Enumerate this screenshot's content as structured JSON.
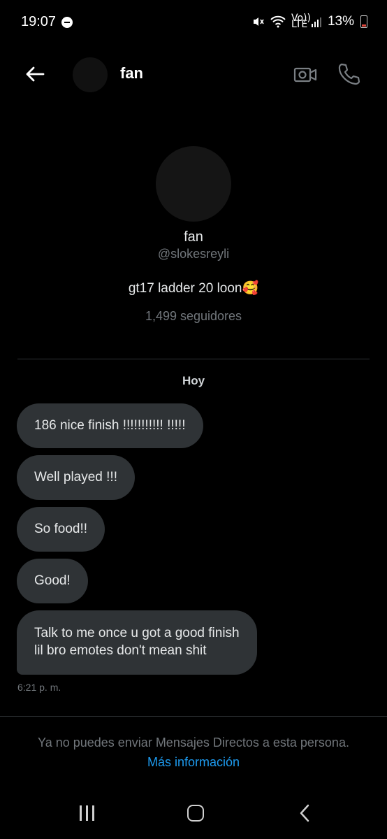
{
  "status_bar": {
    "time": "19:07",
    "battery": "13%",
    "volte": "Vo)) LTE"
  },
  "header": {
    "name": "fan"
  },
  "profile": {
    "name": "fan",
    "handle": "@slokesreyli",
    "bio": "gt17 ladder 20 loon🥰",
    "followers": "1,499 seguidores"
  },
  "conversation": {
    "day_label": "Hoy",
    "messages": [
      "186 nice finish !!!!!!!!!!! !!!!!",
      "Well played !!!",
      "So food!!",
      "Good!",
      "Talk to me once u got a good finish\nlil bro emotes don't mean shit"
    ],
    "timestamp": "6:21 p. m."
  },
  "footer": {
    "notice": "Ya no puedes enviar Mensajes Directos a esta persona.",
    "link": "Más información"
  },
  "colors": {
    "background": "#000000",
    "bubble": "#2f3336",
    "muted_text": "#71767b",
    "link": "#1d9bf0"
  }
}
